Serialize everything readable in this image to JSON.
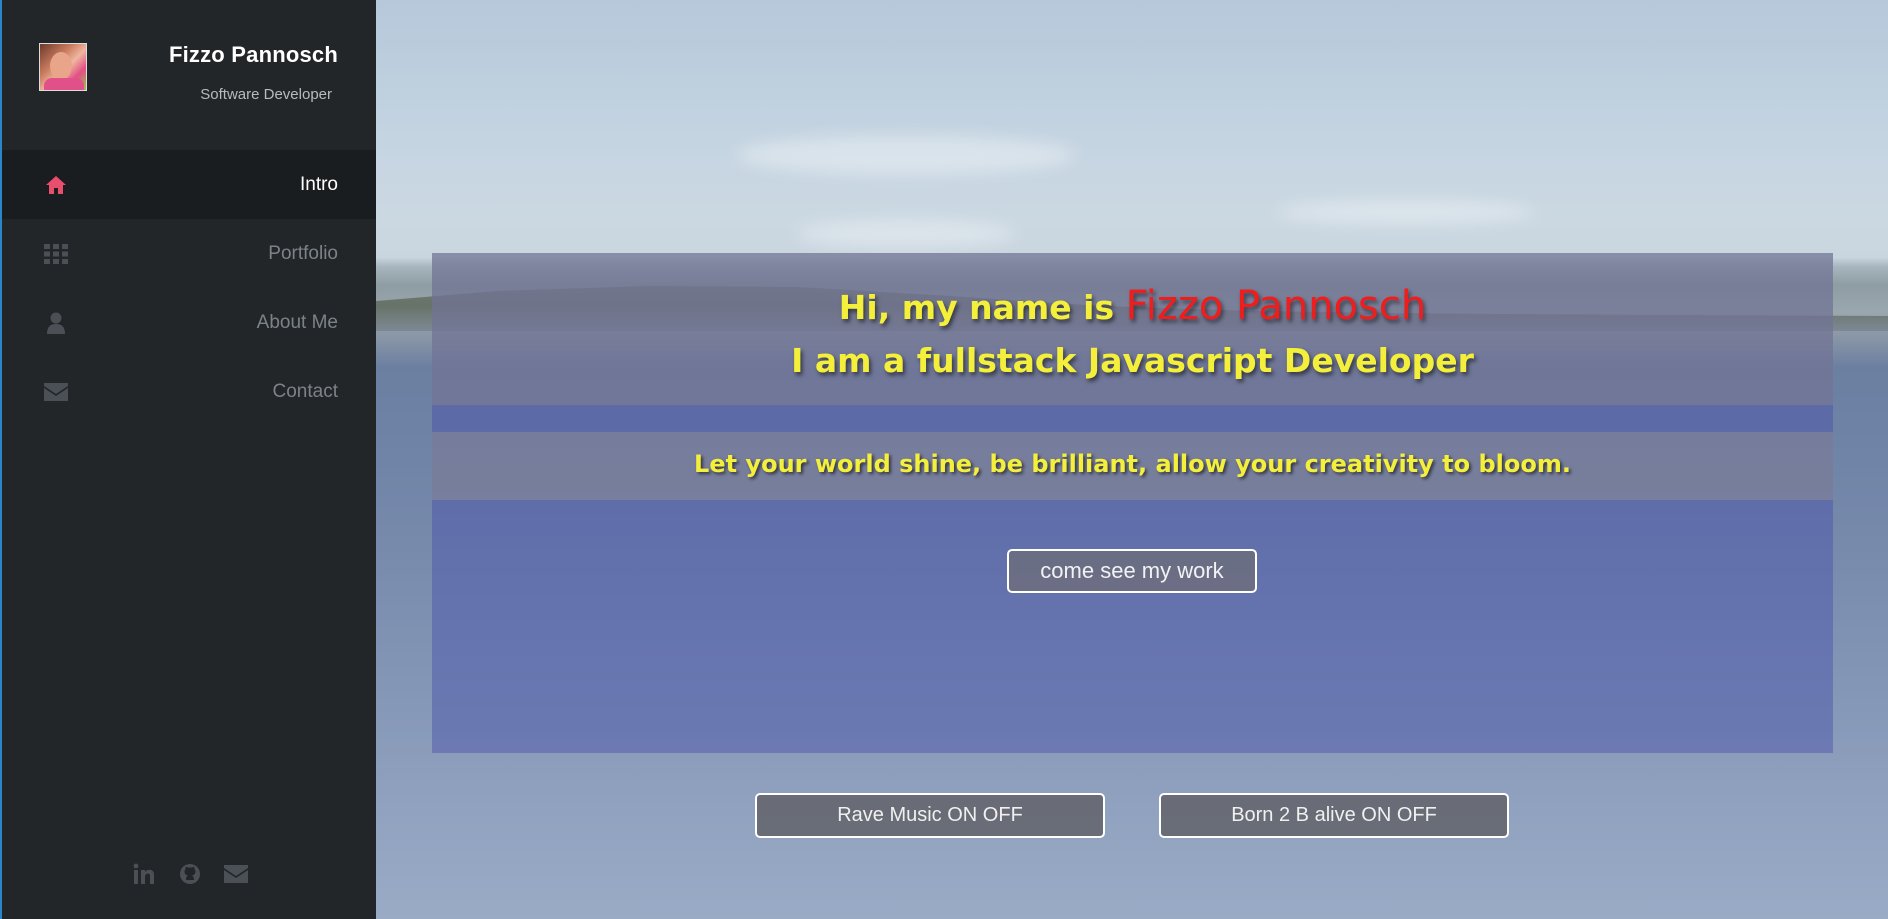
{
  "profile": {
    "name": "Fizzo Pannosch",
    "title": "Software Developer",
    "avatar_icon": "profile-photo"
  },
  "nav": {
    "items": [
      {
        "label": "Intro",
        "icon": "home-icon",
        "active": true
      },
      {
        "label": "Portfolio",
        "icon": "grid-icon",
        "active": false
      },
      {
        "label": "About Me",
        "icon": "user-icon",
        "active": false
      },
      {
        "label": "Contact",
        "icon": "envelope-icon",
        "active": false
      }
    ]
  },
  "footer": {
    "icons": [
      "linkedin-icon",
      "github-icon",
      "envelope-icon"
    ]
  },
  "hero": {
    "greeting": "Hi, my name is ",
    "name": "Fizzo Pannosch",
    "subtitle": "I am a fullstack Javascript Developer",
    "tagline": "Let your world shine, be brilliant, allow your creativity to bloom.",
    "cta_label": "come see my work"
  },
  "music": {
    "rave_label": "Rave Music ON OFF",
    "born_label": "Born 2 B alive ON OFF"
  },
  "colors": {
    "accent_active": "#e94e6d",
    "sidebar_bg": "#222629",
    "hero_text": "#f3ef3a",
    "hero_name": "#f01d1d"
  }
}
